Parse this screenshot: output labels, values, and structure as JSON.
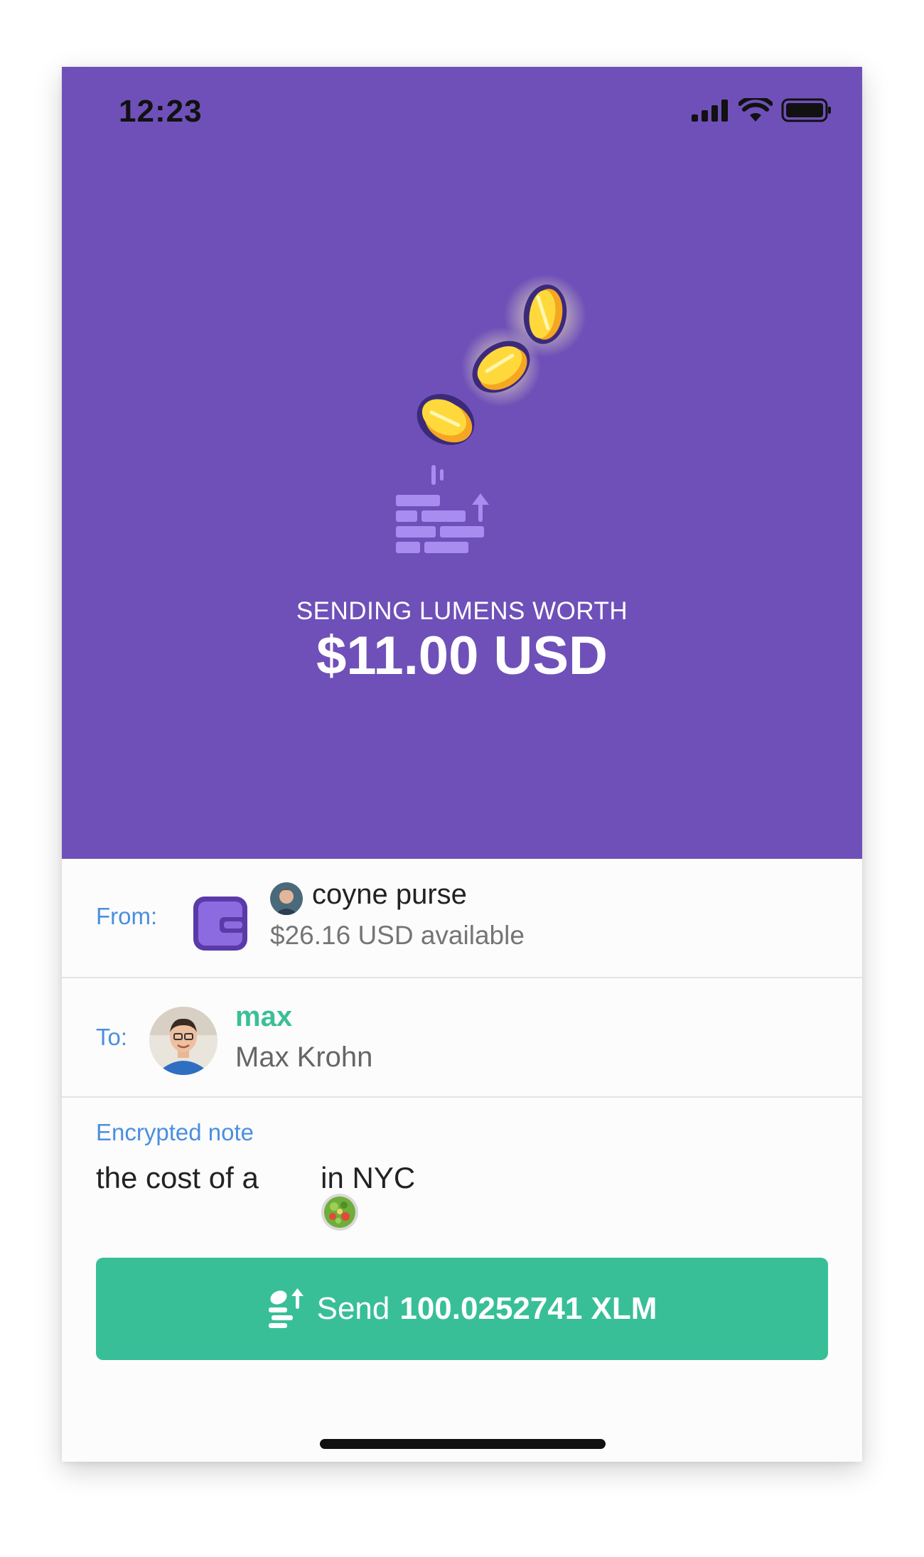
{
  "status_bar": {
    "time": "12:23",
    "icons": [
      "signal-icon",
      "wifi-icon",
      "battery-icon"
    ]
  },
  "hero": {
    "background": "#6f50b8",
    "illustration": "coins-flying-icon",
    "label": "SENDING LUMENS WORTH",
    "amount": "$11.00 USD"
  },
  "from": {
    "label": "From:",
    "wallet_icon": "wallet-icon",
    "account_name": "coyne purse",
    "available": "$26.16 USD available"
  },
  "to": {
    "label": "To:",
    "username": "max",
    "full_name": "Max Krohn"
  },
  "note": {
    "label": "Encrypted note",
    "text_before": "the cost of a ",
    "emoji": "salad-emoji",
    "text_after": " in NYC"
  },
  "send_button": {
    "icon": "send-coins-icon",
    "label": "Send",
    "amount": "100.0252741 XLM",
    "color": "#38bf98"
  },
  "colors": {
    "accent_blue": "#4a8fe0",
    "username_green": "#3bbf97"
  }
}
